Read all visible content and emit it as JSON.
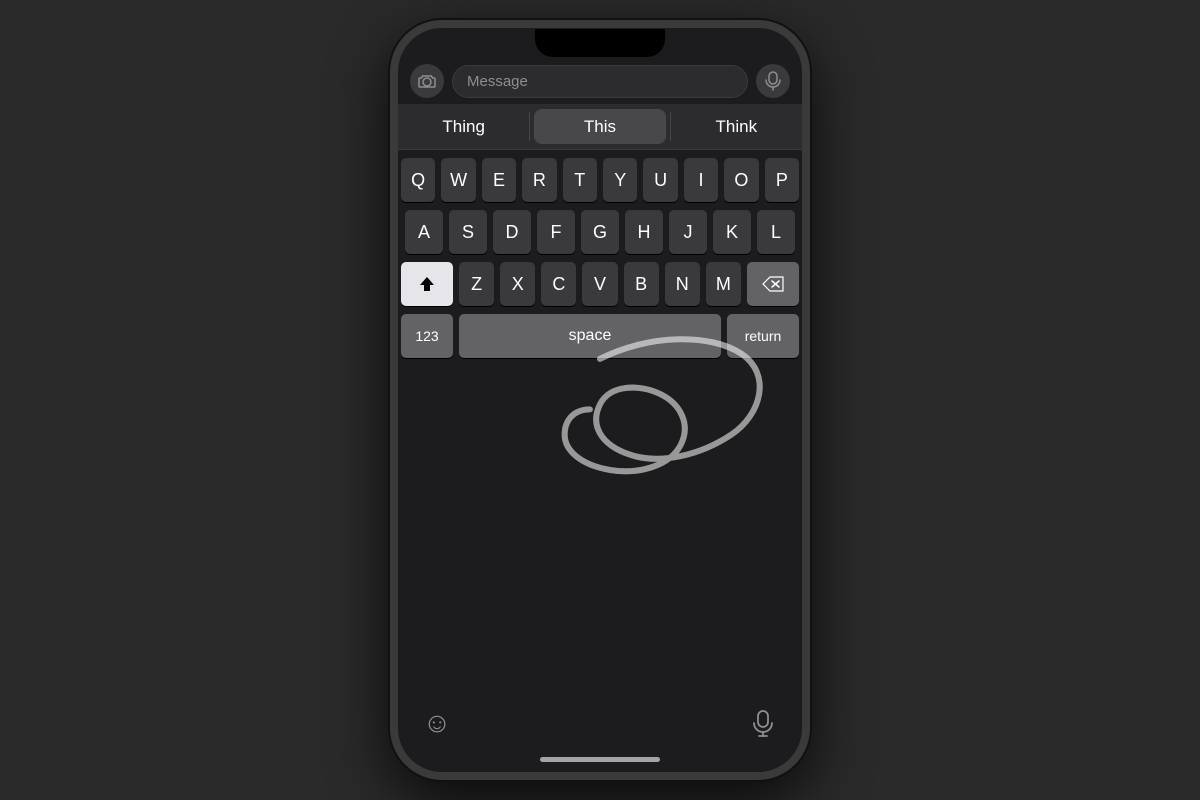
{
  "phone": {
    "screen": {
      "message_placeholder": "Message",
      "predictive": {
        "left": "Thing",
        "center": "This",
        "right": "Think"
      },
      "keyboard": {
        "row1": [
          "Q",
          "W",
          "E",
          "R",
          "T",
          "Y",
          "U",
          "I",
          "O",
          "P"
        ],
        "row2": [
          "A",
          "S",
          "D",
          "F",
          "G",
          "H",
          "J",
          "K",
          "L"
        ],
        "row3": [
          "Z",
          "X",
          "C",
          "V",
          "B",
          "N",
          "M"
        ],
        "special": {
          "shift": "⬆",
          "delete": "⌫",
          "numbers": "123",
          "space": "space",
          "return": "return"
        }
      },
      "bottom": {
        "emoji": "☺",
        "home_indicator": ""
      }
    }
  }
}
